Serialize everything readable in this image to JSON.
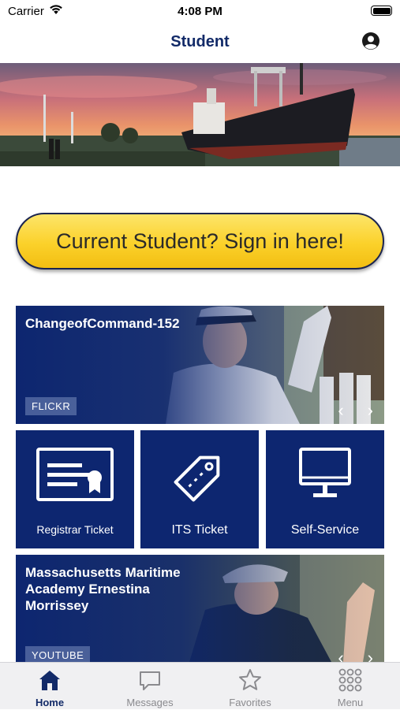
{
  "status_bar": {
    "carrier": "Carrier",
    "time": "4:08 PM"
  },
  "nav": {
    "title": "Student",
    "profile_icon": "person-circle-icon"
  },
  "signin_button": "Current Student? Sign in here!",
  "cards": [
    {
      "title": "ChangeofCommand-152",
      "tag": "FLICKR"
    },
    {
      "title": "Massachusetts Maritime Academy Ernestina Morrissey",
      "tag": "YOUTUBE"
    }
  ],
  "tiles": [
    {
      "label": "Registrar Ticket",
      "icon": "certificate-icon"
    },
    {
      "label": "ITS Ticket",
      "icon": "ticket-tag-icon"
    },
    {
      "label": "Self-Service",
      "icon": "monitor-icon"
    }
  ],
  "tabs": [
    {
      "label": "Home",
      "icon": "home-icon",
      "active": true
    },
    {
      "label": "Messages",
      "icon": "chat-bubble-icon"
    },
    {
      "label": "Favorites",
      "icon": "star-icon"
    },
    {
      "label": "Menu",
      "icon": "grid-dots-icon"
    }
  ],
  "colors": {
    "navy": "#0d2670",
    "title_navy": "#122a68",
    "button_yellow": "#fbd12a"
  }
}
